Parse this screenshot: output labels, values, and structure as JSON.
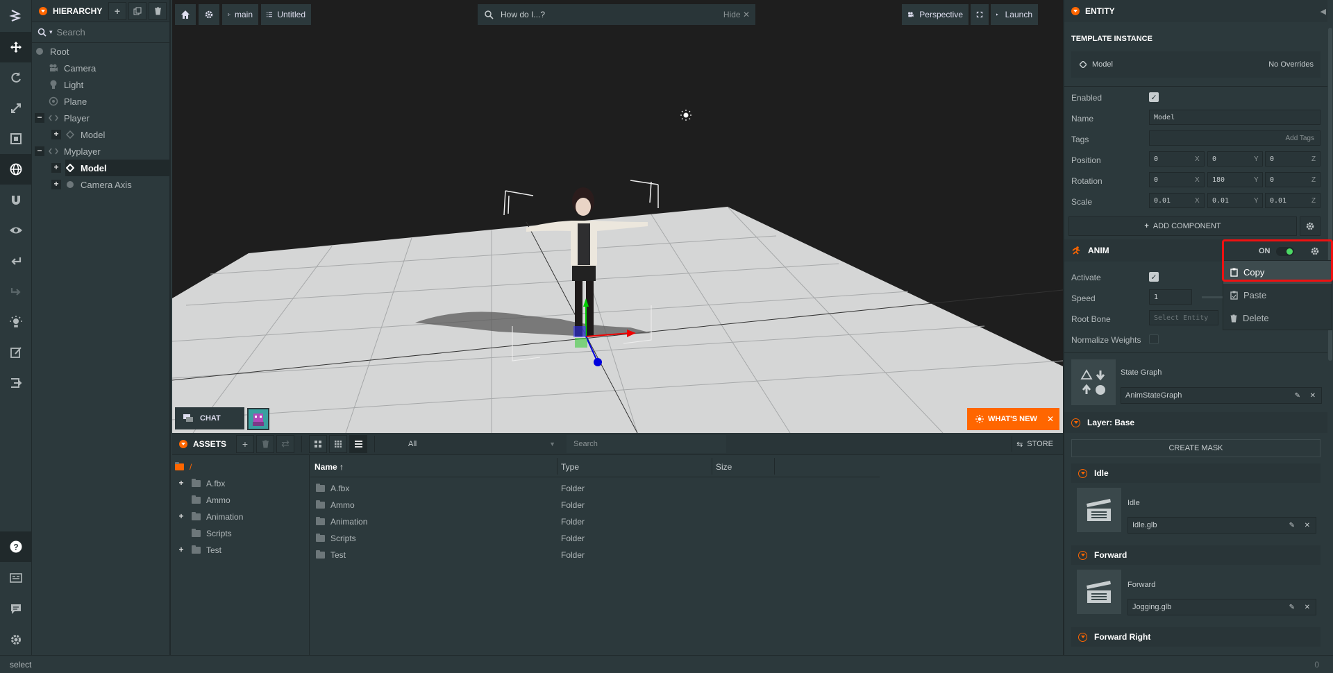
{
  "hierarchy": {
    "title": "HIERARCHY",
    "search_placeholder": "Search",
    "items": [
      {
        "label": "Root"
      },
      {
        "label": "Camera"
      },
      {
        "label": "Light"
      },
      {
        "label": "Plane"
      },
      {
        "label": "Player"
      },
      {
        "label": "Model"
      },
      {
        "label": "Myplayer"
      },
      {
        "label": "Model"
      },
      {
        "label": "Camera Axis"
      }
    ]
  },
  "viewport": {
    "branch": "main",
    "scene": "Untitled",
    "search_text": "How do I...?",
    "hide_label": "Hide",
    "camera": "Perspective",
    "launch": "Launch",
    "chat": "CHAT",
    "whats_new": "WHAT'S NEW"
  },
  "assets": {
    "title": "ASSETS",
    "filter": "All",
    "search_placeholder": "Search",
    "store": "STORE",
    "root": "/",
    "folders": [
      "A.fbx",
      "Ammo",
      "Animation",
      "Scripts",
      "Test"
    ],
    "columns": [
      "Name",
      "Type",
      "Size"
    ],
    "rows": [
      {
        "name": "A.fbx",
        "type": "Folder",
        "size": ""
      },
      {
        "name": "Ammo",
        "type": "Folder",
        "size": ""
      },
      {
        "name": "Animation",
        "type": "Folder",
        "size": ""
      },
      {
        "name": "Scripts",
        "type": "Folder",
        "size": ""
      },
      {
        "name": "Test",
        "type": "Folder",
        "size": ""
      }
    ]
  },
  "inspector": {
    "title": "ENTITY",
    "template_instance": "TEMPLATE INSTANCE",
    "template_name": "Model",
    "overrides": "No Overrides",
    "enabled_label": "Enabled",
    "name_label": "Name",
    "name_value": "Model",
    "tags_label": "Tags",
    "add_tags": "Add Tags",
    "position_label": "Position",
    "position": [
      "0",
      "0",
      "0"
    ],
    "rotation_label": "Rotation",
    "rotation": [
      "0",
      "180",
      "0"
    ],
    "scale_label": "Scale",
    "scale": [
      "0.01",
      "0.01",
      "0.01"
    ],
    "axes": [
      "X",
      "Y",
      "Z"
    ],
    "add_component": "ADD COMPONENT",
    "anim": {
      "title": "ANIM",
      "toggle": "ON",
      "activate_label": "Activate",
      "speed_label": "Speed",
      "speed_value": "1",
      "root_bone_label": "Root Bone",
      "root_bone_placeholder": "Select Entity",
      "normalize_label": "Normalize Weights",
      "state_graph_label": "State Graph",
      "state_graph_value": "AnimStateGraph",
      "layer": "Layer: Base",
      "create_mask": "CREATE MASK",
      "states": [
        {
          "title": "Idle",
          "label": "Idle",
          "asset": "Idle.glb"
        },
        {
          "title": "Forward",
          "label": "Forward",
          "asset": "Jogging.glb"
        },
        {
          "title": "Forward Right"
        }
      ]
    },
    "context_menu": [
      "Copy",
      "Paste",
      "Delete"
    ]
  },
  "status": {
    "text": "select",
    "count": "0"
  }
}
